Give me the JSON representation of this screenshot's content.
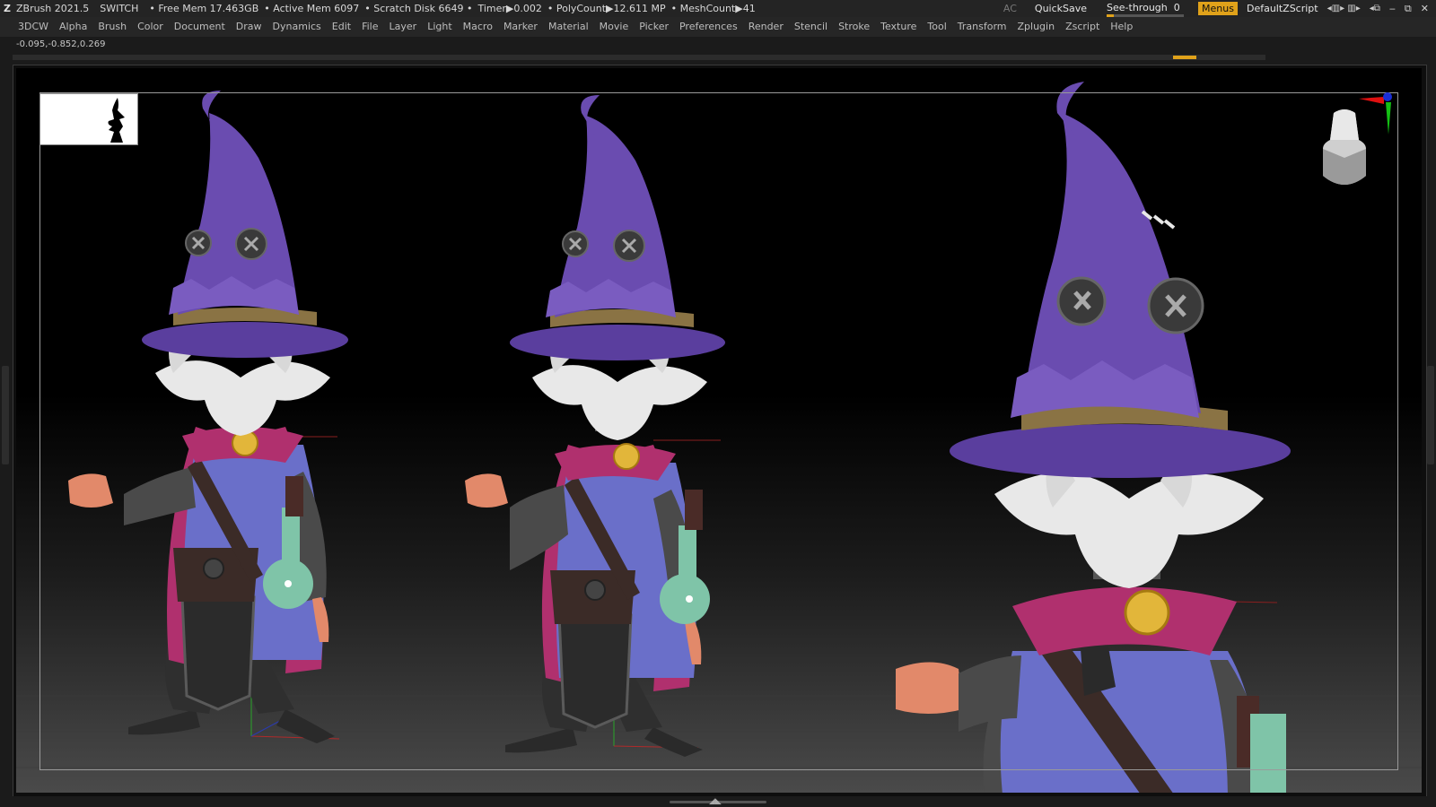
{
  "titlebar": {
    "app": "ZBrush 2021.5",
    "switch_label": "SWITCH",
    "free_mem": "• Free Mem 17.463GB",
    "active_mem": "• Active Mem 6097",
    "scratch_disk": "• Scratch Disk 6649 •",
    "timer": "Timer▶0.002",
    "polycount": "• PolyCount▶12.611 MP",
    "meshcount": "• MeshCount▶41",
    "ac_label": "AC",
    "quicksave_label": "QuickSave",
    "see_through_label": "See-through",
    "see_through_value": "0",
    "menus_label": "Menus",
    "defaultzscript_label": "DefaultZScript"
  },
  "menubar": {
    "items": [
      "3DCW",
      "Alpha",
      "Brush",
      "Color",
      "Document",
      "Draw",
      "Dynamics",
      "Edit",
      "File",
      "Layer",
      "Light",
      "Macro",
      "Marker",
      "Material",
      "Movie",
      "Picker",
      "Preferences",
      "Render",
      "Stencil",
      "Stroke",
      "Texture",
      "Tool",
      "Transform",
      "Zplugin",
      "Zscript",
      "Help"
    ]
  },
  "status": {
    "coords": "-0.095,-0.852,0.269"
  },
  "colors": {
    "accent": "#e0a21a",
    "hat": "#6a4cb0",
    "robe": "#6a6fc9",
    "cape": "#b0306e",
    "beard": "#e8e8e8",
    "skin": "#e2896a",
    "leather": "#3b2b27",
    "flask": "#7fc4a8"
  },
  "icons": [
    "zbrush-logo-icon",
    "window-minimize-icon",
    "window-restore-icon",
    "window-close-icon",
    "navigation-cube-icon",
    "axis-gizmo-icon",
    "thumbnail-silhouette-icon"
  ]
}
